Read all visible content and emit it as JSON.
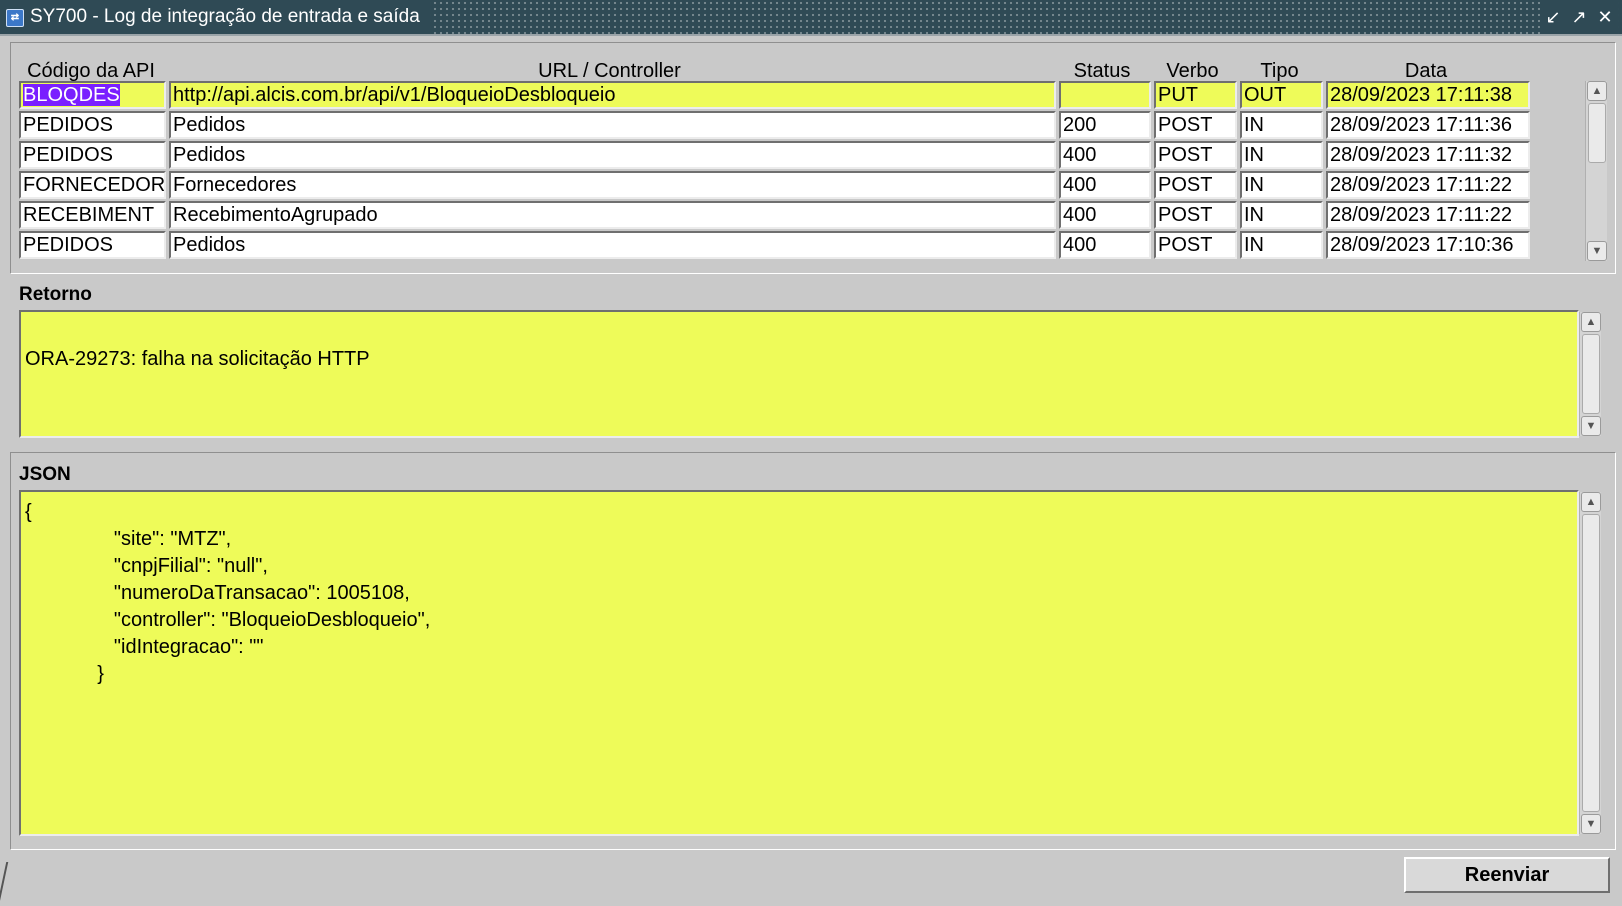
{
  "window": {
    "title": "SY700 - Log de integração de entrada e saída",
    "controls": [
      "minimize-icon",
      "maximize-icon",
      "close-icon"
    ]
  },
  "grid": {
    "headers": {
      "codigo": "Código da API",
      "url": "URL / Controller",
      "status": "Status",
      "verbo": "Verbo",
      "tipo": "Tipo",
      "data": "Data"
    },
    "rows": [
      {
        "codigo": "BLOQDES",
        "url": "http://api.alcis.com.br/api/v1/BloqueioDesbloqueio",
        "status": "",
        "verbo": "PUT",
        "tipo": "OUT",
        "data": "28/09/2023 17:11:38"
      },
      {
        "codigo": "PEDIDOS",
        "url": "Pedidos",
        "status": "200",
        "verbo": "POST",
        "tipo": "IN",
        "data": "28/09/2023 17:11:36"
      },
      {
        "codigo": "PEDIDOS",
        "url": "Pedidos",
        "status": "400",
        "verbo": "POST",
        "tipo": "IN",
        "data": "28/09/2023 17:11:32"
      },
      {
        "codigo": "FORNECEDOR",
        "url": "Fornecedores",
        "status": "400",
        "verbo": "POST",
        "tipo": "IN",
        "data": "28/09/2023 17:11:22"
      },
      {
        "codigo": "RECEBIMENT",
        "url": "RecebimentoAgrupado",
        "status": "400",
        "verbo": "POST",
        "tipo": "IN",
        "data": "28/09/2023 17:11:22"
      },
      {
        "codigo": "PEDIDOS",
        "url": "Pedidos",
        "status": "400",
        "verbo": "POST",
        "tipo": "IN",
        "data": "28/09/2023 17:10:36"
      }
    ]
  },
  "retorno": {
    "label": "Retorno",
    "text": "ORA-29273: falha na solicitação HTTP"
  },
  "json_section": {
    "label": "JSON",
    "lines": [
      "{",
      "                \"site\": \"MTZ\",",
      "                \"cnpjFilial\": \"null\",",
      "                \"numeroDaTransacao\": 1005108,",
      "                \"controller\": \"BloqueioDesbloqueio\",",
      "                \"idIntegracao\": \"\"",
      "             }"
    ]
  },
  "actions": {
    "reenviar": "Reenviar"
  },
  "colors": {
    "highlight": "#eefb59",
    "selection": "#7a1fff",
    "titlebar": "#2f4a55",
    "background": "#c9c9c9"
  }
}
